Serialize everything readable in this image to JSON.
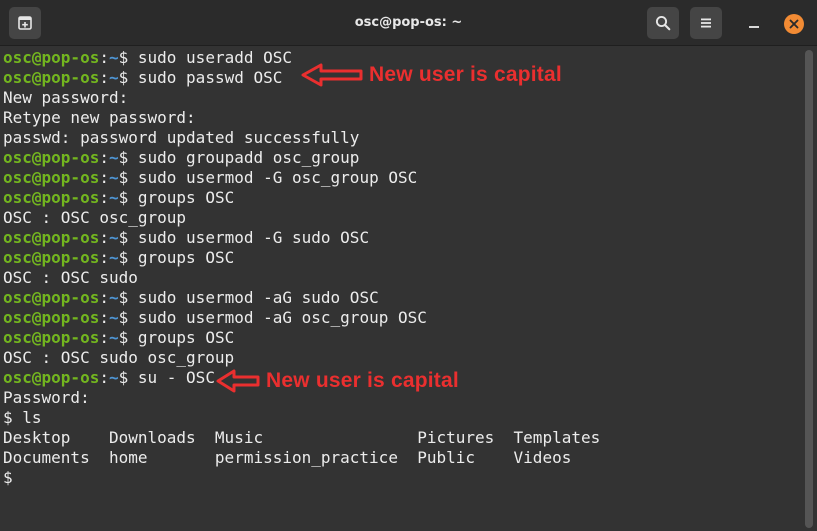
{
  "window": {
    "title": "osc@pop-os: ~"
  },
  "icons": {
    "new_tab": "new-tab-icon",
    "search": "search-icon",
    "menu": "hamburger-menu-icon",
    "minimize": "minimize-icon",
    "close": "close-icon"
  },
  "colors": {
    "background": "#333333",
    "titlebar": "#2b2b2b",
    "prompt_user": "#73b61f",
    "prompt_path": "#4f97d7",
    "text": "#ececec",
    "annotation": "#ea2f2f",
    "close_button": "#f28b34"
  },
  "prompt": {
    "user": "osc@pop-os",
    "colon": ":",
    "path": "~",
    "symbol": "$"
  },
  "terminal": {
    "lines": [
      {
        "type": "prompt",
        "text": " sudo useradd OSC"
      },
      {
        "type": "prompt",
        "text": " sudo passwd OSC"
      },
      {
        "type": "output",
        "text": "New password:"
      },
      {
        "type": "output",
        "text": "Retype new password:"
      },
      {
        "type": "output",
        "text": "passwd: password updated successfully"
      },
      {
        "type": "prompt",
        "text": " sudo groupadd osc_group"
      },
      {
        "type": "prompt",
        "text": " sudo usermod -G osc_group OSC"
      },
      {
        "type": "prompt",
        "text": " groups OSC"
      },
      {
        "type": "output",
        "text": "OSC : OSC osc_group"
      },
      {
        "type": "prompt",
        "text": " sudo usermod -G sudo OSC"
      },
      {
        "type": "prompt",
        "text": " groups OSC"
      },
      {
        "type": "output",
        "text": "OSC : OSC sudo"
      },
      {
        "type": "prompt",
        "text": " sudo usermod -aG sudo OSC"
      },
      {
        "type": "prompt",
        "text": " sudo usermod -aG osc_group OSC"
      },
      {
        "type": "prompt",
        "text": " groups OSC"
      },
      {
        "type": "output",
        "text": "OSC : OSC sudo osc_group"
      },
      {
        "type": "prompt",
        "text": " su - OSC"
      },
      {
        "type": "output",
        "text": "Password:"
      },
      {
        "type": "output",
        "text": "$ ls"
      },
      {
        "type": "output",
        "text": "Desktop    Downloads  Music                Pictures  Templates"
      },
      {
        "type": "output",
        "text": "Documents  home       permission_practice  Public    Videos"
      },
      {
        "type": "output",
        "text": "$"
      }
    ]
  },
  "annotations": [
    {
      "label": "New user is capital"
    },
    {
      "label": "New user is capital"
    }
  ]
}
